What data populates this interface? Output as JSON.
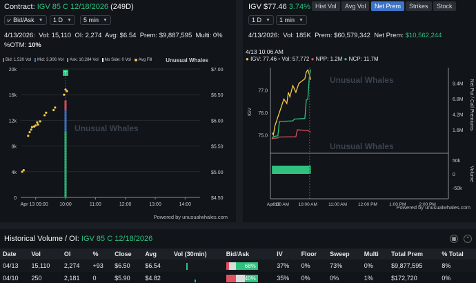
{
  "left": {
    "contract_label": "Contract:",
    "contract_name": "IGV 85 C 12/18/2026",
    "days": "(249D)",
    "controls": {
      "bid_ask": "Bid/Ask",
      "interval": "1 D",
      "bar_size": "5 min"
    },
    "stats": {
      "date": "4/13/2026:",
      "vol": "Vol: 15,110",
      "oi": "OI: 2,274",
      "avg": "Avg: $6.54",
      "prem": "Prem: $9,887,595",
      "multi": "Multi: 0%",
      "otm_label": "%OTM:",
      "otm_value": "10%"
    },
    "legend": {
      "bid": "Bid: 1,520 Vol",
      "mid": "Mid: 3,306 Vol",
      "ask": "Ask: 10,284 Vol",
      "noside": "No Side: 0 Vol",
      "avgfill": "Avg Fill",
      "brand": "Unusual Whales"
    },
    "watermark": "Unusual Whales",
    "powered": "Powered by unusualwhales.com",
    "marker_label": "T"
  },
  "right": {
    "ticker": "IGV",
    "price": "$77.46",
    "change": "3.74%",
    "tabs": [
      "Hist Vol",
      "Avg Vol",
      "Net Prem",
      "Strikes",
      "Stock"
    ],
    "active_tab": "Net Prem",
    "controls": {
      "interval": "1 D",
      "bar_size": "1 min"
    },
    "stats": {
      "date": "4/13/2026:",
      "vol": "Vol: 185K",
      "prem": "Prem: $60,579,342",
      "ncp_label": "Net Prem:",
      "ncp_value": "$10,562,244"
    },
    "tooltip": {
      "time": "4/13 10:06 AM",
      "igv": "IGV: 77.46",
      "vol": "Vol: 57,772",
      "npp": "NPP: 1.2M",
      "ncp": "NCP: 11.7M"
    },
    "watermark": "Unusual Whales",
    "y_axis_title": "IGV",
    "right_axis_title": "Net Put / Call Premiums",
    "vol_axis_title": "Volume",
    "powered": "Powered by unusualwhales.com"
  },
  "bottom": {
    "title_label": "Historical Volume / OI:",
    "title_contract": "IGV 85 C 12/18/2026",
    "columns": [
      "Date",
      "Vol",
      "OI",
      "%",
      "Close",
      "Avg",
      "Vol (30min)",
      "Bid/Ask",
      "IV",
      "Floor",
      "Sweep",
      "Multi",
      "Total Prem",
      "% Total"
    ],
    "rows": [
      {
        "date": "04/13",
        "vol": "15,110",
        "oi": "2,274",
        "pct": "+93",
        "close": "$6.50",
        "avg": "$6.54",
        "ba": "68%",
        "bid": 0.1,
        "mid": 0.22,
        "iv": "37%",
        "floor": "0%",
        "sweep": "73%",
        "multi": "0%",
        "total": "$9,877,595",
        "ptotal": "8%"
      },
      {
        "date": "04/10",
        "vol": "250",
        "oi": "2,181",
        "pct": "0",
        "close": "$5.90",
        "avg": "$4.82",
        "ba": "40%",
        "bid": 0.3,
        "mid": 0.3,
        "iv": "35%",
        "floor": "0%",
        "sweep": "0%",
        "multi": "1%",
        "total": "$172,720",
        "ptotal": "0%"
      }
    ]
  },
  "chart_data": [
    {
      "type": "scatter",
      "title": "",
      "y_left_ticks": [
        "0",
        "4k",
        "8k",
        "12k",
        "16k",
        "20k"
      ],
      "y_left_range": [
        0,
        20000
      ],
      "y_right_ticks": [
        "$4.50",
        "$5.00",
        "$5.50",
        "$6.00",
        "$6.50",
        "$7.00"
      ],
      "y_right_range": [
        4.5,
        7.0
      ],
      "x_ticks": [
        "Apr 13 09:00",
        "10:00",
        "11:00",
        "12:00",
        "13:00",
        "14:00"
      ],
      "x_range_hours": [
        8.5,
        14.5
      ],
      "volume_bar": {
        "time": 10.0,
        "ask": 10284,
        "mid": 3306,
        "bid": 1520
      },
      "avg_fill": {
        "x": [
          8.55,
          8.6,
          8.75,
          8.8,
          8.85,
          8.88,
          8.95,
          9.0,
          9.05,
          9.08,
          9.15,
          9.3,
          9.35,
          9.6,
          9.65,
          9.95,
          10.0,
          10.05
        ],
        "y": [
          5.0,
          5.03,
          5.7,
          5.77,
          5.82,
          5.87,
          5.88,
          5.9,
          5.96,
          5.92,
          5.98,
          6.1,
          6.15,
          6.2,
          6.25,
          6.5,
          6.6,
          6.57
        ]
      }
    },
    {
      "type": "line",
      "title": "",
      "y_left_ticks": [
        "75.0",
        "76.0",
        "77.0"
      ],
      "y_left_range": [
        74.8,
        78.0
      ],
      "y_right_ticks": [
        "1.6M",
        "4.2M",
        "6.8M",
        "9.4M"
      ],
      "x_ticks": [
        "Apr 13",
        "9:00 AM",
        "10:00 AM",
        "11:00 AM",
        "12:00 PM",
        "1:00 PM",
        "2:00 PM"
      ],
      "x_range_hours": [
        8.75,
        14.7
      ],
      "vol_ticks": [
        "50k",
        "0",
        "-50k"
      ],
      "series": [
        {
          "name": "IGV",
          "color": "#f6c94c",
          "x": [
            8.8,
            8.85,
            8.9,
            9.0,
            9.1,
            9.2,
            9.3,
            9.35,
            9.4,
            9.5,
            9.6,
            9.7,
            9.8,
            9.9,
            9.95,
            10.0,
            10.05,
            10.1
          ],
          "y": [
            75.1,
            75.0,
            75.4,
            75.8,
            76.2,
            76.6,
            76.4,
            76.9,
            76.7,
            77.2,
            76.9,
            77.3,
            77.4,
            77.5,
            77.8,
            77.9,
            77.7,
            77.46
          ]
        },
        {
          "name": "NCP",
          "color": "#2ec27e",
          "x": [
            8.8,
            8.85,
            9.0,
            9.05,
            9.5,
            9.55,
            9.9,
            9.95,
            10.0,
            10.05,
            10.1
          ],
          "y": [
            0.1,
            0.5,
            0.6,
            3.0,
            3.1,
            3.4,
            3.5,
            6.6,
            6.7,
            10.5,
            11.7
          ]
        },
        {
          "name": "NPP",
          "color": "#e05260",
          "x": [
            8.8,
            8.85,
            9.0,
            9.05,
            9.6,
            9.65,
            10.0,
            10.1
          ],
          "y": [
            0.1,
            0.2,
            0.25,
            0.4,
            0.45,
            1.6,
            1.5,
            1.2
          ]
        }
      ],
      "volume": {
        "x_start": 8.8,
        "x_end": 10.1,
        "value": 30000
      }
    }
  ]
}
